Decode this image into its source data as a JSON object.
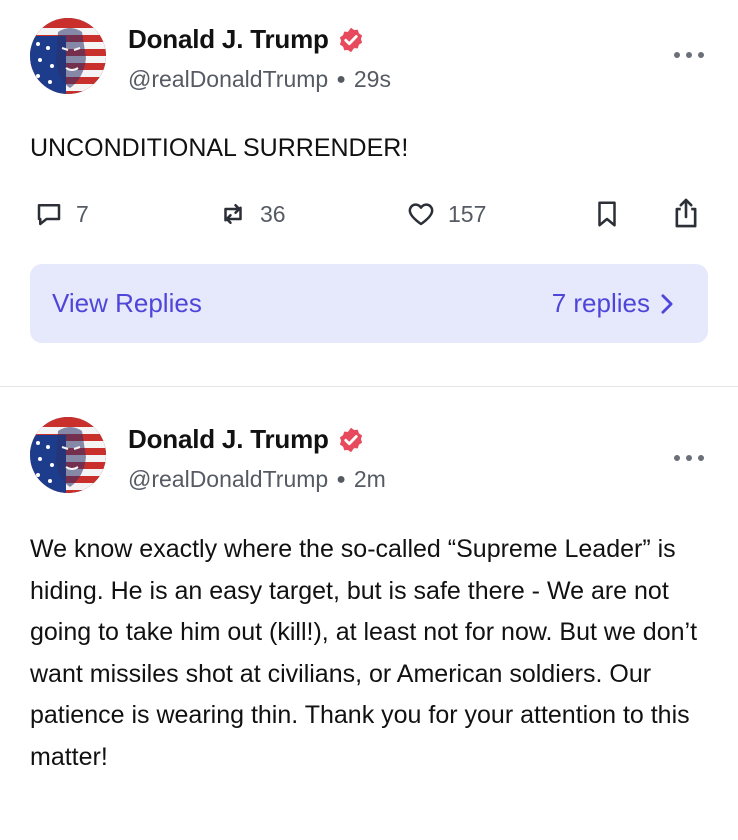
{
  "posts": [
    {
      "author": "Donald J. Trump",
      "handle": "@realDonaldTrump",
      "time": "29s",
      "text": "UNCONDITIONAL SURRENDER!",
      "stats": {
        "replies": "7",
        "reposts": "36",
        "likes": "157"
      },
      "replies_bar": {
        "view_label": "View Replies",
        "count_label": "7 replies"
      }
    },
    {
      "author": "Donald J. Trump",
      "handle": "@realDonaldTrump",
      "time": "2m",
      "text": "We know exactly where the so-called “Supreme Leader” is hiding. He is an easy target, but is safe there - We are not going to take him out (kill!), at least not for now. But we don’t want missiles shot at civilians, or American soldiers. Our patience is wearing thin. Thank you for your attention to this matter!"
    }
  ],
  "icons": {
    "verified": "verified-badge-icon",
    "more": "more-options-icon",
    "reply": "comment-icon",
    "repost": "repost-icon",
    "like": "heart-icon",
    "bookmark": "bookmark-icon",
    "share": "share-icon",
    "chevron": "chevron-right-icon"
  },
  "colors": {
    "accent": "#4f46d9",
    "replies_bar_bg": "#e6e8fc",
    "verified": "#e74a5c",
    "muted": "#555a63"
  }
}
